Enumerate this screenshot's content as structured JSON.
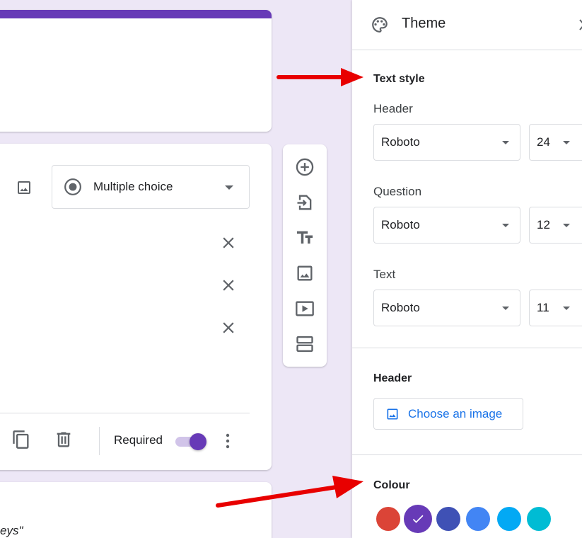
{
  "form": {
    "question": {
      "type_label": "Multiple choice",
      "required_label": "Required",
      "required_on": true
    },
    "partial_text": "eys\""
  },
  "panel": {
    "title": "Theme",
    "text_style": {
      "heading": "Text style",
      "header": {
        "label": "Header",
        "font": "Roboto",
        "size": "24"
      },
      "question": {
        "label": "Question",
        "font": "Roboto",
        "size": "12"
      },
      "text": {
        "label": "Text",
        "font": "Roboto",
        "size": "11"
      }
    },
    "header_section": {
      "heading": "Header",
      "choose_label": "Choose an image"
    },
    "colour": {
      "heading": "Colour",
      "swatches": [
        "#db4437",
        "#673ab7",
        "#3f51b5",
        "#4285f4",
        "#03a9f4",
        "#00bcd4"
      ],
      "selected_index": 1
    }
  },
  "toolbar": {
    "icons": [
      "add-question-icon",
      "import-questions-icon",
      "add-title-icon",
      "add-image-icon",
      "add-video-icon",
      "add-section-icon"
    ]
  },
  "colors": {
    "accent": "#673ab7",
    "link": "#1a73e8",
    "annotation_arrow": "#e80000"
  }
}
